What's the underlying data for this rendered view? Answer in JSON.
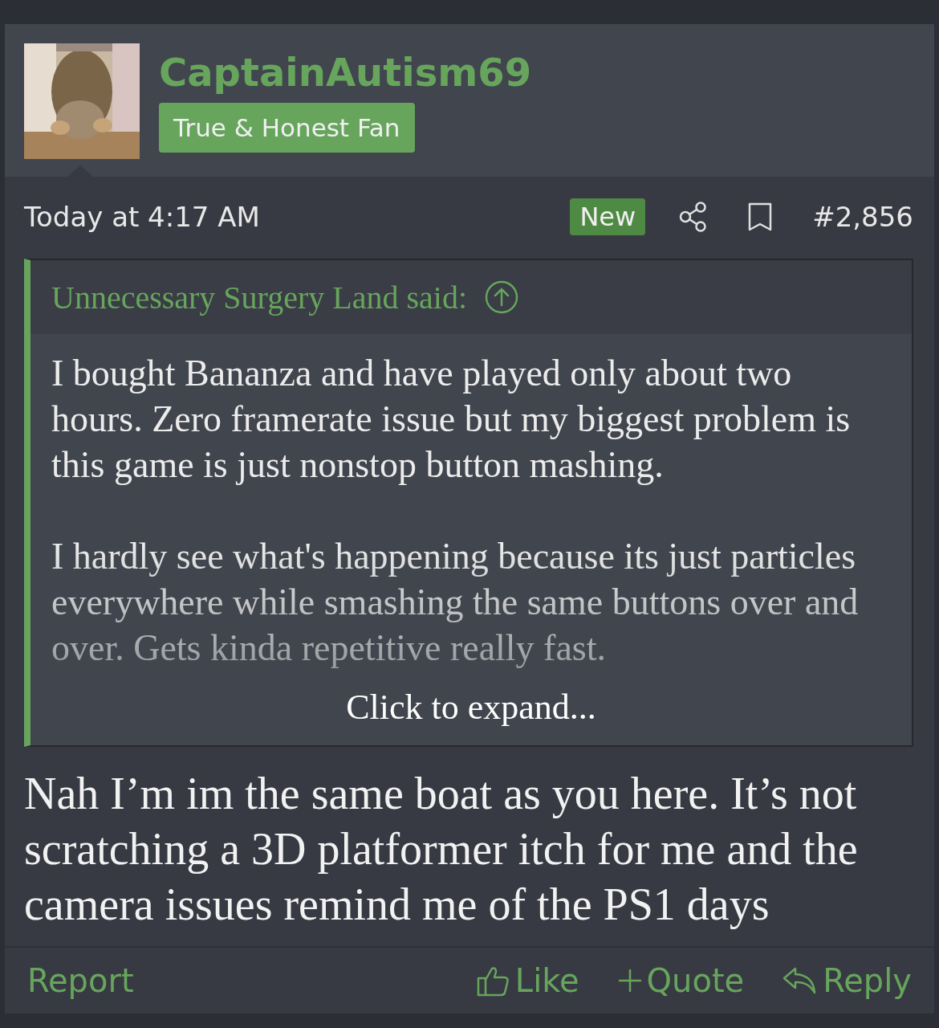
{
  "post": {
    "author": {
      "name": "CaptainAutism69",
      "title": "True & Honest Fan"
    },
    "meta": {
      "date": "Today at 4:17 AM",
      "badge": "New",
      "number": "#2,856"
    },
    "quote": {
      "author": "Unnecessary Surgery Land said:",
      "expanded": false,
      "expand_link": "Click to expand...",
      "paragraphs": [
        "I bought Bananza and have played only about two hours. Zero framerate issue but my biggest problem is this game is just nonstop button mashing.",
        "I hardly see what's happening because its just particles everywhere while smashing the same buttons over and over. Gets kinda repetitive really fast."
      ]
    },
    "body": "Nah I’m im the same boat as you here. It’s not scratching a 3D platformer itch for me and the camera issues remind me of the PS1 days",
    "actions": {
      "report": "Report",
      "buttons": [
        {
          "label": "Like",
          "kind": "like"
        },
        {
          "label": "Quote",
          "kind": "quote"
        },
        {
          "label": "Reply",
          "kind": "reply"
        }
      ]
    }
  }
}
